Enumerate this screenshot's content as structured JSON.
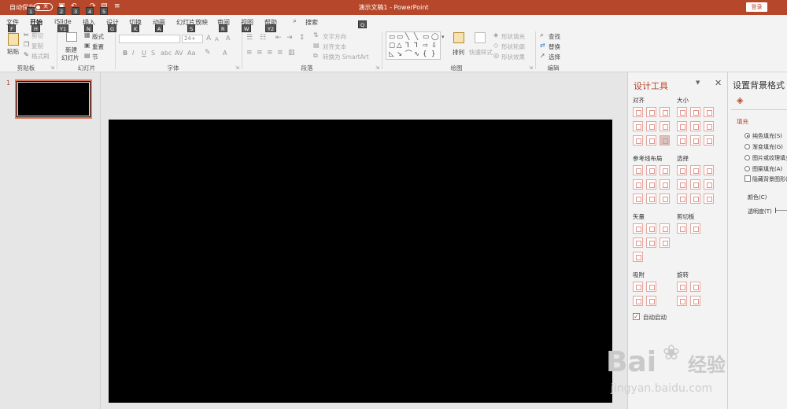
{
  "titlebar": {
    "autosave": "自动保存",
    "toggle": "关",
    "title": "演示文稿1 - PowerPoint",
    "login": "登录"
  },
  "menu": {
    "tabs": [
      "文件",
      "开始",
      "iSlide",
      "插入",
      "设计",
      "切换",
      "动画",
      "幻灯片放映",
      "审阅",
      "视图",
      "帮助"
    ],
    "search": "搜索"
  },
  "keytips": {
    "qat": [
      "1",
      "2",
      "3",
      "4",
      "5"
    ],
    "tabs": [
      "F",
      "H",
      "Y1",
      "N",
      "G",
      "K",
      "A",
      "S",
      "R",
      "W",
      "Y2"
    ],
    "search": "Q"
  },
  "ribbon": {
    "clipboard": {
      "paste": "粘贴",
      "cut": "剪切",
      "copy": "复制",
      "painter": "格式刷",
      "label": "剪贴板"
    },
    "slides": {
      "new": "新建",
      "new2": "幻灯片",
      "layout": "版式",
      "reset": "重置",
      "section": "节",
      "label": "幻灯片"
    },
    "font": {
      "size": "24+",
      "label": "字体"
    },
    "paragraph": {
      "direction": "文字方向",
      "align": "对齐文本",
      "smartart": "转换为 SmartArt",
      "label": "段落"
    },
    "drawing": {
      "arrange": "排列",
      "quickstyle": "快速样式",
      "fill": "形状填充",
      "outline": "形状轮廓",
      "effect": "形状效果",
      "label": "绘图"
    },
    "editing": {
      "find": "查找",
      "replace": "替换",
      "select": "选择",
      "label": "编辑"
    }
  },
  "slides_pane": {
    "number": "1"
  },
  "design_tools": {
    "title": "设计工具",
    "sections": {
      "align": "对齐",
      "size": "大小",
      "guides": "参考线布局",
      "select": "选择",
      "vector": "矢量",
      "clipboard": "剪切板",
      "snap": "吸附",
      "rotate": "旋转"
    },
    "autostart": "自动启动"
  },
  "format_bg": {
    "title": "设置背景格式",
    "fill": "填充",
    "options": [
      "纯色填充(S)",
      "渐变填充(G)",
      "图片或纹理填充",
      "图案填充(A)"
    ],
    "hide": "隐藏背景图形(H",
    "color": "颜色(C)",
    "transparency": "透明度(T)"
  },
  "watermark": {
    "brand": "Bai",
    "brand2": "经验",
    "url": "jingyan.baidu.com"
  },
  "colors": {
    "accent": "#b7472a",
    "slide": "#000000"
  }
}
